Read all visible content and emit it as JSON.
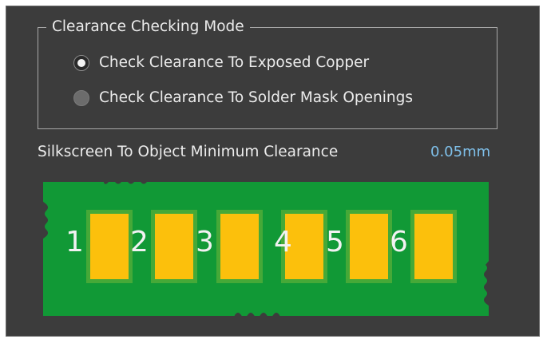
{
  "group": {
    "title": "Clearance Checking Mode",
    "options": [
      {
        "label": "Check Clearance To Exposed Copper",
        "selected": true
      },
      {
        "label": "Check Clearance To Solder Mask Openings",
        "selected": false
      }
    ]
  },
  "clearance": {
    "label": "Silkscreen To Object Minimum Clearance",
    "value": "0.05mm"
  },
  "board": {
    "pad_labels": [
      "1",
      "2",
      "3",
      "4",
      "5",
      "6"
    ]
  },
  "colors": {
    "panel": "#3c3c3c",
    "board_green": "#119936",
    "pad_yellow": "#fcc00c",
    "value_blue": "#7fc0ea"
  }
}
